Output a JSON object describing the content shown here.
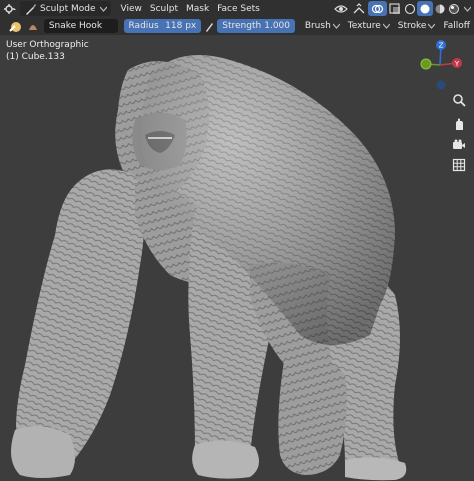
{
  "header": {
    "mode_label": "Sculpt Mode",
    "menus": [
      "View",
      "Sculpt",
      "Mask",
      "Face Sets"
    ]
  },
  "toolbar": {
    "brush_name": "Snake Hook",
    "radius_label": "Radius",
    "radius_value": "118 px",
    "strength_label": "Strength",
    "strength_value": "1.000",
    "menus": [
      "Brush",
      "Texture",
      "Stroke",
      "Falloff"
    ]
  },
  "viewport": {
    "view_name": "User Orthographic",
    "object_name": "(1) Cube.133",
    "gizmo_z_label": "Z",
    "gizmo_y_label": "Y"
  },
  "colors": {
    "accent_blue": "#4772b3",
    "header_bg": "#303030",
    "viewport_bg": "#3d3d3d",
    "axis_z": "#2f6fd6",
    "axis_y": "#6a9a22",
    "axis_x": "#c4374a"
  },
  "icons": [
    "gorilla-sculpt-image",
    "sculpt-mode-icon",
    "brush-icon",
    "pen-pressure-icon",
    "zoom-icon",
    "camera-icon",
    "grid-icon",
    "overlay-icon",
    "shading-solid-icon"
  ]
}
